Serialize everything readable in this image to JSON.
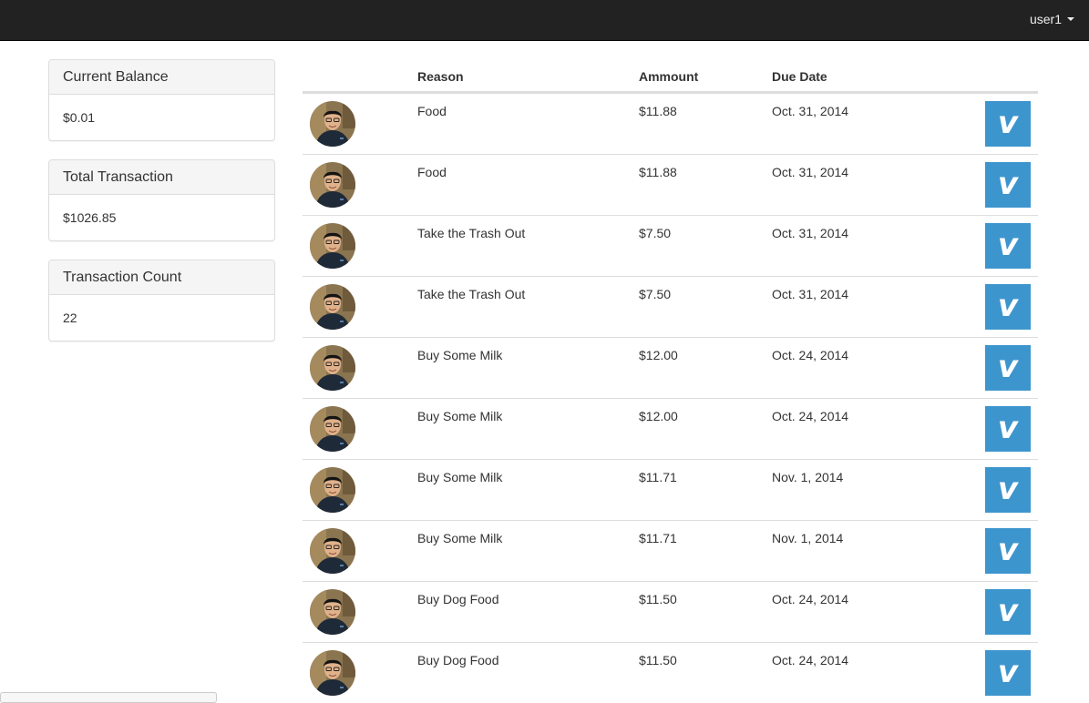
{
  "navbar": {
    "user_label": "user1"
  },
  "sidebar": {
    "panels": [
      {
        "title": "Current Balance",
        "value": "$0.01"
      },
      {
        "title": "Total Transaction",
        "value": "$1026.85"
      },
      {
        "title": "Transaction Count",
        "value": "22"
      }
    ]
  },
  "table": {
    "headers": {
      "avatar": "",
      "reason": "Reason",
      "amount": "Ammount",
      "due_date": "Due Date"
    },
    "rows": [
      {
        "reason": "Food",
        "amount": "$11.88",
        "due_date": "Oct. 31, 2014"
      },
      {
        "reason": "Food",
        "amount": "$11.88",
        "due_date": "Oct. 31, 2014"
      },
      {
        "reason": "Take the Trash Out",
        "amount": "$7.50",
        "due_date": "Oct. 31, 2014"
      },
      {
        "reason": "Take the Trash Out",
        "amount": "$7.50",
        "due_date": "Oct. 31, 2014"
      },
      {
        "reason": "Buy Some Milk",
        "amount": "$12.00",
        "due_date": "Oct. 24, 2014"
      },
      {
        "reason": "Buy Some Milk",
        "amount": "$12.00",
        "due_date": "Oct. 24, 2014"
      },
      {
        "reason": "Buy Some Milk",
        "amount": "$11.71",
        "due_date": "Nov. 1, 2014"
      },
      {
        "reason": "Buy Some Milk",
        "amount": "$11.71",
        "due_date": "Nov. 1, 2014"
      },
      {
        "reason": "Buy Dog Food",
        "amount": "$11.50",
        "due_date": "Oct. 24, 2014"
      },
      {
        "reason": "Buy Dog Food",
        "amount": "$11.50",
        "due_date": "Oct. 24, 2014"
      }
    ],
    "pay_button_glyph": "v",
    "pay_button_icon": "venmo-icon",
    "avatar_icon": "user-avatar-photo"
  },
  "colors": {
    "navbar_bg": "#222222",
    "venmo_blue": "#3d95ce",
    "panel_heading_bg": "#f5f5f5",
    "border": "#dddddd"
  }
}
